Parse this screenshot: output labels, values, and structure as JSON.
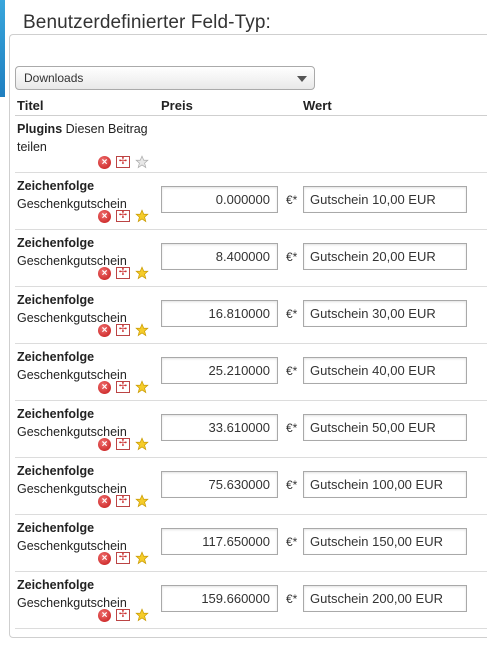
{
  "legend": "Benutzerdefinierter Feld-Typ:",
  "type_select": {
    "value": "Downloads"
  },
  "headers": {
    "title": "Titel",
    "price": "Preis",
    "value": "Wert"
  },
  "currency": "€*",
  "plugins_row": {
    "bold": "Plugins",
    "text": "Diesen Beitrag teilen",
    "star_active": false
  },
  "rows": [
    {
      "title": "Zeichenfolge",
      "subtitle": "Geschenkgutschein",
      "price": "0.000000",
      "value": "Gutschein 10,00 EUR"
    },
    {
      "title": "Zeichenfolge",
      "subtitle": "Geschenkgutschein",
      "price": "8.400000",
      "value": "Gutschein 20,00 EUR"
    },
    {
      "title": "Zeichenfolge",
      "subtitle": "Geschenkgutschein",
      "price": "16.810000",
      "value": "Gutschein 30,00 EUR"
    },
    {
      "title": "Zeichenfolge",
      "subtitle": "Geschenkgutschein",
      "price": "25.210000",
      "value": "Gutschein 40,00 EUR"
    },
    {
      "title": "Zeichenfolge",
      "subtitle": "Geschenkgutschein",
      "price": "33.610000",
      "value": "Gutschein 50,00 EUR"
    },
    {
      "title": "Zeichenfolge",
      "subtitle": "Geschenkgutschein",
      "price": "75.630000",
      "value": "Gutschein 100,00 EUR"
    },
    {
      "title": "Zeichenfolge",
      "subtitle": "Geschenkgutschein",
      "price": "117.650000",
      "value": "Gutschein 150,00 EUR"
    },
    {
      "title": "Zeichenfolge",
      "subtitle": "Geschenkgutschein",
      "price": "159.660000",
      "value": "Gutschein 200,00 EUR"
    }
  ],
  "icons": {
    "delete": "delete-icon",
    "move": "move-icon",
    "star": "star-icon"
  },
  "colors": {
    "accent": "#2f95d4",
    "delete": "#d42424",
    "star": "#f2c21b"
  }
}
